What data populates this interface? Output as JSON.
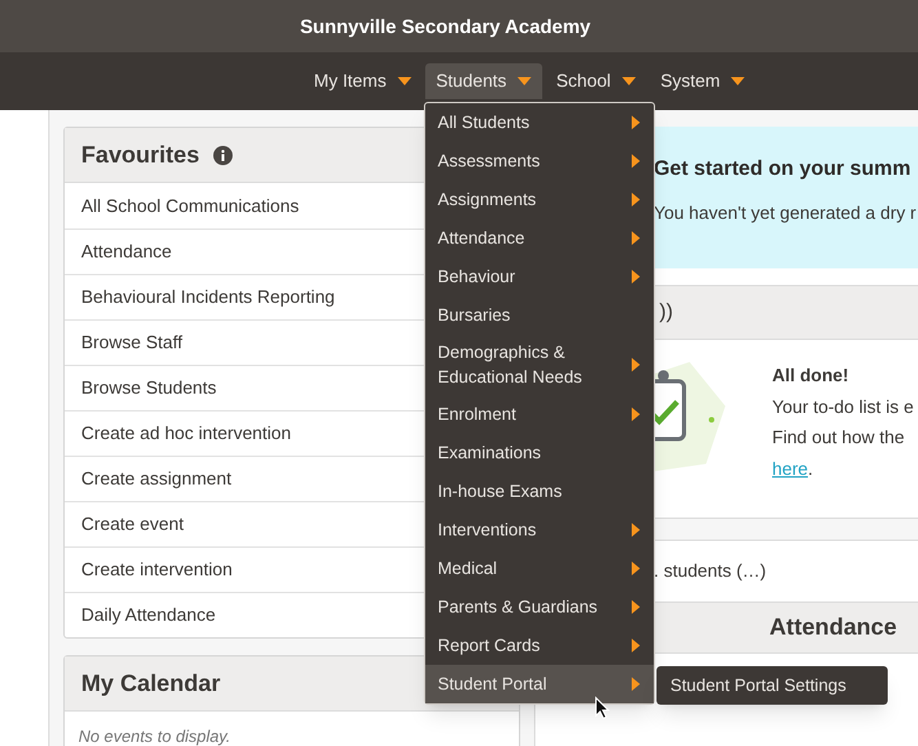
{
  "header": {
    "title": "Sunnyville Secondary Academy"
  },
  "nav": [
    {
      "label": "My Items",
      "selected": false
    },
    {
      "label": "Students",
      "selected": true
    },
    {
      "label": "School",
      "selected": false
    },
    {
      "label": "System",
      "selected": false
    }
  ],
  "favourites": {
    "title": "Favourites",
    "items": [
      "All School Communications",
      "Attendance",
      "Behavioural Incidents Reporting",
      "Browse Staff",
      "Browse Students",
      "Create ad hoc intervention",
      "Create assignment",
      "Create event",
      "Create intervention",
      "Daily Attendance"
    ]
  },
  "calendar": {
    "title": "My Calendar",
    "empty_text": "No events to display."
  },
  "banner": {
    "title": "Get started on your summ",
    "text": "You haven't yet generated a dry r"
  },
  "todo": {
    "header_text": "))",
    "title": "All done!",
    "lines": [
      "Your to-do list is e",
      "Find out how the"
    ],
    "link": "here",
    "after_link": "."
  },
  "students_row": ". students (…)",
  "attendance": {
    "title": "Attendance"
  },
  "menu": {
    "items": [
      {
        "label": "All Students",
        "has_submenu": true,
        "selected": false
      },
      {
        "label": "Assessments",
        "has_submenu": true,
        "selected": false
      },
      {
        "label": "Assignments",
        "has_submenu": true,
        "selected": false
      },
      {
        "label": "Attendance",
        "has_submenu": true,
        "selected": false
      },
      {
        "label": "Behaviour",
        "has_submenu": true,
        "selected": false
      },
      {
        "label": "Bursaries",
        "has_submenu": false,
        "selected": false
      },
      {
        "label": "Demographics & Educational Needs",
        "has_submenu": true,
        "selected": false
      },
      {
        "label": "Enrolment",
        "has_submenu": true,
        "selected": false
      },
      {
        "label": "Examinations",
        "has_submenu": false,
        "selected": false
      },
      {
        "label": "In-house Exams",
        "has_submenu": false,
        "selected": false
      },
      {
        "label": "Interventions",
        "has_submenu": true,
        "selected": false
      },
      {
        "label": "Medical",
        "has_submenu": true,
        "selected": false
      },
      {
        "label": "Parents & Guardians",
        "has_submenu": true,
        "selected": false
      },
      {
        "label": "Report Cards",
        "has_submenu": true,
        "selected": false
      },
      {
        "label": "Student Portal",
        "has_submenu": true,
        "selected": true
      }
    ],
    "submenu": [
      {
        "label": "Student Portal Settings"
      }
    ]
  }
}
